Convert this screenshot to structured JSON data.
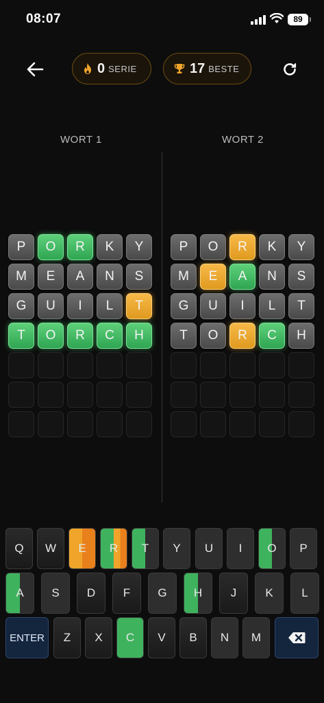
{
  "status": {
    "time": "08:07",
    "battery": "89"
  },
  "header": {
    "streak_value": "0",
    "streak_label": "SERIE",
    "best_value": "17",
    "best_label": "BESTE"
  },
  "boards": [
    {
      "label": "WORT 1",
      "rows": [
        [
          [
            "P",
            "gray"
          ],
          [
            "O",
            "green"
          ],
          [
            "R",
            "green"
          ],
          [
            "K",
            "gray"
          ],
          [
            "Y",
            "gray"
          ]
        ],
        [
          [
            "M",
            "gray"
          ],
          [
            "E",
            "gray"
          ],
          [
            "A",
            "gray"
          ],
          [
            "N",
            "gray"
          ],
          [
            "S",
            "gray"
          ]
        ],
        [
          [
            "G",
            "gray"
          ],
          [
            "U",
            "gray"
          ],
          [
            "I",
            "gray"
          ],
          [
            "L",
            "gray"
          ],
          [
            "T",
            "yellow"
          ]
        ],
        [
          [
            "T",
            "green"
          ],
          [
            "O",
            "green"
          ],
          [
            "R",
            "green"
          ],
          [
            "C",
            "green"
          ],
          [
            "H",
            "green"
          ]
        ]
      ]
    },
    {
      "label": "WORT 2",
      "rows": [
        [
          [
            "P",
            "gray"
          ],
          [
            "O",
            "gray"
          ],
          [
            "R",
            "yellow"
          ],
          [
            "K",
            "gray"
          ],
          [
            "Y",
            "gray"
          ]
        ],
        [
          [
            "M",
            "gray"
          ],
          [
            "E",
            "yellow"
          ],
          [
            "A",
            "green"
          ],
          [
            "N",
            "gray"
          ],
          [
            "S",
            "gray"
          ]
        ],
        [
          [
            "G",
            "gray"
          ],
          [
            "U",
            "gray"
          ],
          [
            "I",
            "gray"
          ],
          [
            "L",
            "gray"
          ],
          [
            "T",
            "gray"
          ]
        ],
        [
          [
            "T",
            "gray"
          ],
          [
            "O",
            "gray"
          ],
          [
            "R",
            "yellow"
          ],
          [
            "C",
            "green"
          ],
          [
            "H",
            "gray"
          ]
        ]
      ]
    }
  ],
  "empty_rows": 3,
  "colors": {
    "green": "#3fb25e",
    "yellow": "#f0a52a",
    "orange": "#e8801c",
    "gray": "#2e2e2e"
  },
  "keyboard": {
    "enter_label": "ENTER",
    "backspace_icon": "backspace-icon",
    "rows": [
      [
        [
          "Q",
          "none",
          "none"
        ],
        [
          "W",
          "none",
          "none"
        ],
        [
          "E",
          "yellow",
          "orange"
        ],
        [
          "R",
          "green",
          "yellow-orange"
        ],
        [
          "T",
          "green",
          "gray"
        ],
        [
          "Y",
          "gray",
          "gray"
        ],
        [
          "U",
          "gray",
          "gray"
        ],
        [
          "I",
          "gray",
          "gray"
        ],
        [
          "O",
          "green",
          "gray"
        ],
        [
          "P",
          "gray",
          "gray"
        ]
      ],
      [
        [
          "A",
          "green",
          "gray"
        ],
        [
          "S",
          "gray",
          "gray"
        ],
        [
          "D",
          "none",
          "none"
        ],
        [
          "F",
          "none",
          "none"
        ],
        [
          "G",
          "gray",
          "gray"
        ],
        [
          "H",
          "green",
          "gray"
        ],
        [
          "J",
          "none",
          "none"
        ],
        [
          "K",
          "gray",
          "gray"
        ],
        [
          "L",
          "gray",
          "gray"
        ]
      ],
      [
        [
          "Z",
          "none",
          "none"
        ],
        [
          "X",
          "none",
          "none"
        ],
        [
          "C",
          "green",
          "green"
        ],
        [
          "V",
          "none",
          "none"
        ],
        [
          "B",
          "none",
          "none"
        ],
        [
          "N",
          "gray",
          "gray"
        ],
        [
          "M",
          "gray",
          "gray"
        ]
      ]
    ]
  }
}
